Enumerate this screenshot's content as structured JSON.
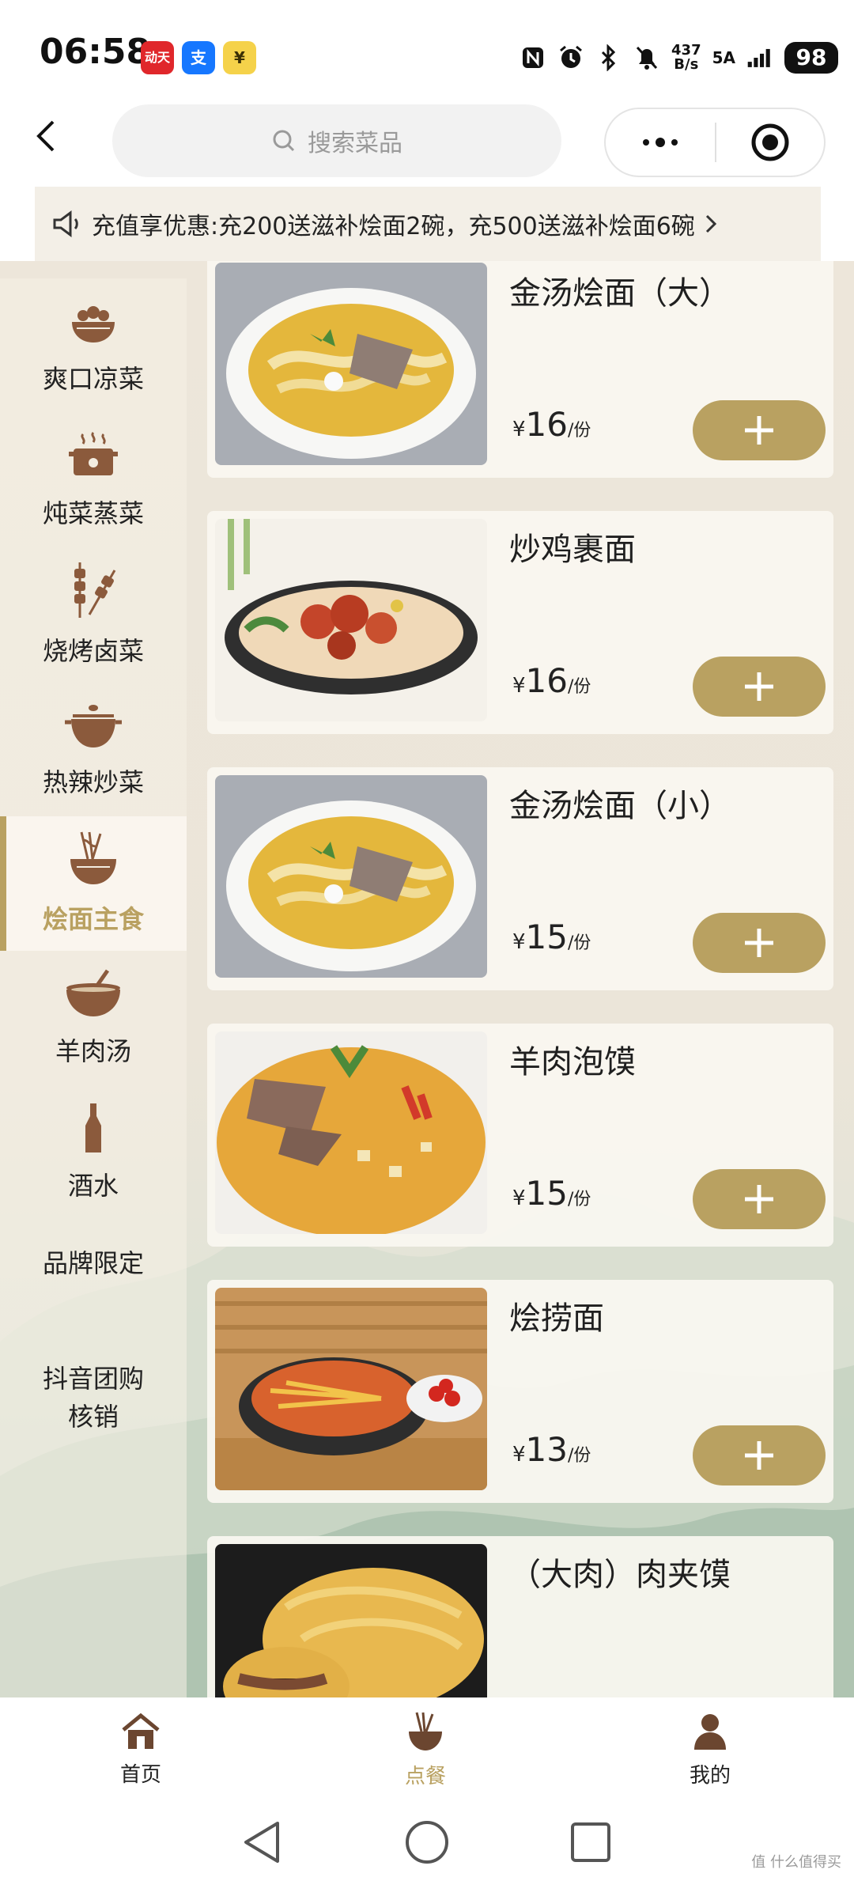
{
  "status_bar": {
    "time": "06:58",
    "app_badges": [
      "动天",
      "支",
      "¥"
    ],
    "net_speed_value": "437",
    "net_speed_unit": "B/s",
    "network": "5A",
    "battery": "98"
  },
  "header": {
    "search_placeholder": "搜索菜品"
  },
  "promo": {
    "text": "充值享优惠:充200送滋补烩面2碗，充500送滋补烩面6碗"
  },
  "sidebar": {
    "categories": [
      {
        "label": "爽口凉菜",
        "icon": "cold-dish-icon"
      },
      {
        "label": "炖菜蒸菜",
        "icon": "steamer-icon"
      },
      {
        "label": "烧烤卤菜",
        "icon": "skewer-icon"
      },
      {
        "label": "热辣炒菜",
        "icon": "pot-icon"
      },
      {
        "label": "烩面主食",
        "icon": "noodle-bowl-icon",
        "active": true
      },
      {
        "label": "羊肉汤",
        "icon": "soup-bowl-icon"
      },
      {
        "label": "酒水",
        "icon": "bottle-icon"
      },
      {
        "label": "品牌限定"
      },
      {
        "label": "抖音团购\n核销"
      }
    ]
  },
  "dishes": [
    {
      "name": "金汤烩面（大）",
      "currency": "¥",
      "price": "16",
      "unit": "/份"
    },
    {
      "name": "炒鸡裹面",
      "currency": "¥",
      "price": "16",
      "unit": "/份"
    },
    {
      "name": "金汤烩面（小）",
      "currency": "¥",
      "price": "15",
      "unit": "/份"
    },
    {
      "name": "羊肉泡馍",
      "currency": "¥",
      "price": "15",
      "unit": "/份"
    },
    {
      "name": "烩捞面",
      "currency": "¥",
      "price": "13",
      "unit": "/份"
    },
    {
      "name": "（大肉）肉夹馍"
    }
  ],
  "tabbar": {
    "tabs": [
      {
        "label": "首页",
        "icon": "home-icon"
      },
      {
        "label": "点餐",
        "icon": "order-noodle-icon",
        "active": true
      },
      {
        "label": "我的",
        "icon": "profile-icon"
      }
    ]
  },
  "watermark": "值 什么值得买",
  "colors": {
    "accent": "#b9a161",
    "background": "#efe9df"
  }
}
